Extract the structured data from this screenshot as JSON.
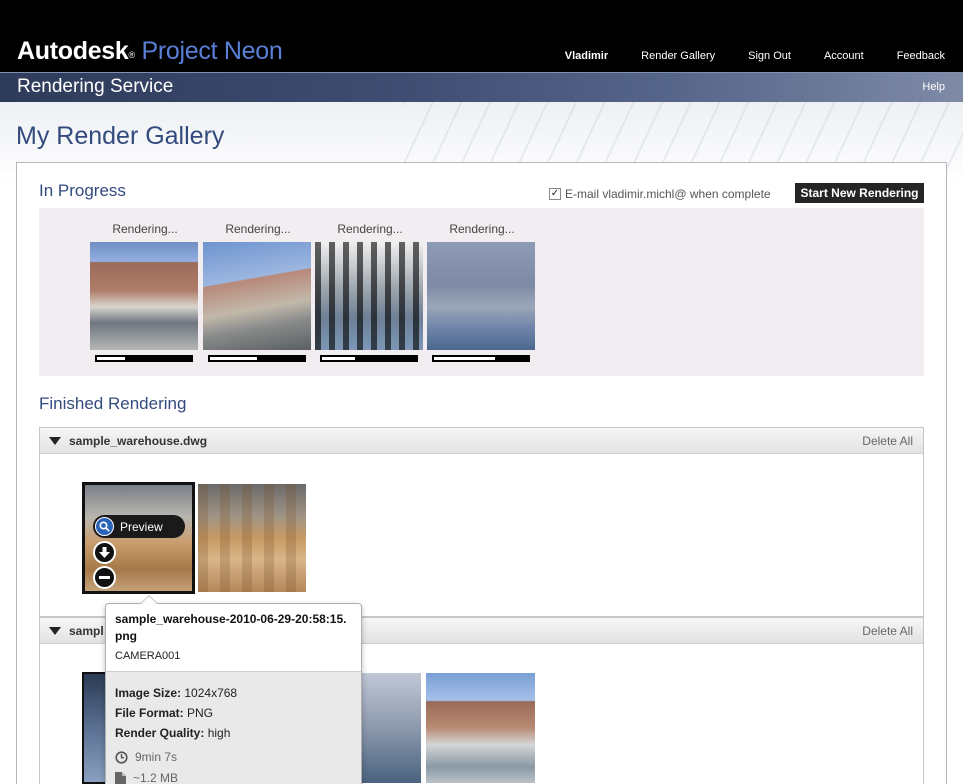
{
  "header": {
    "brand": "Autodesk",
    "reg_mark": "®",
    "product": "Project Neon",
    "nav": {
      "user": "Vladimir",
      "items": [
        "Render Gallery",
        "Sign Out",
        "Account",
        "Feedback"
      ]
    }
  },
  "service_bar": {
    "title": "Rendering Service",
    "help": "Help"
  },
  "page": {
    "title": "My Render Gallery"
  },
  "in_progress": {
    "title": "In Progress",
    "email_label": "E-mail vladimir.michl@ when complete",
    "email_checked": true,
    "start_button": "Start New Rendering",
    "items": [
      {
        "status": "Rendering...",
        "progress": 0.3
      },
      {
        "status": "Rendering...",
        "progress": 0.5
      },
      {
        "status": "Rendering...",
        "progress": 0.35
      },
      {
        "status": "Rendering...",
        "progress": 0.65
      }
    ]
  },
  "finished": {
    "title": "Finished Rendering",
    "groups": [
      {
        "name": "sample_warehouse.dwg",
        "delete_all": "Delete All"
      },
      {
        "name": "sampl",
        "delete_all": "Delete All"
      }
    ]
  },
  "thumb_actions": {
    "preview": "Preview"
  },
  "tooltip": {
    "filename": "sample_warehouse-2010-06-29-20:58:15.png",
    "camera": "CAMERA001",
    "image_size_label": "Image Size:",
    "image_size": "1024x768",
    "file_format_label": "File Format:",
    "file_format": "PNG",
    "render_quality_label": "Render Quality:",
    "render_quality": "high",
    "time": "9min 7s",
    "file_size": "~1.2 MB"
  }
}
